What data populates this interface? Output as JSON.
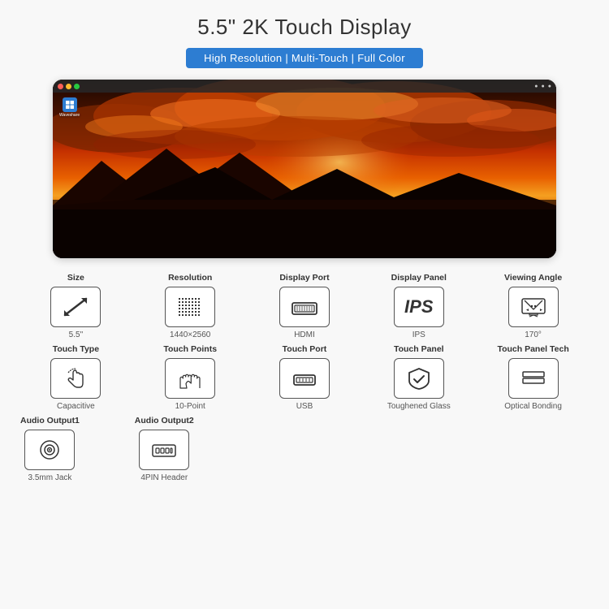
{
  "page": {
    "title": "5.5\" 2K Touch Display",
    "badge": "High Resolution | Multi-Touch | Full Color"
  },
  "specs_row1": [
    {
      "label": "Size",
      "value": "5.5\"",
      "icon": "diagonal-arrow"
    },
    {
      "label": "Resolution",
      "value": "1440×2560",
      "icon": "grid-dots"
    },
    {
      "label": "Display Port",
      "value": "HDMI",
      "icon": "hdmi-port"
    },
    {
      "label": "Display Panel",
      "value": "IPS",
      "icon": "ips-text"
    },
    {
      "label": "Viewing Angle",
      "value": "170°",
      "icon": "viewing-angle"
    }
  ],
  "specs_row2": [
    {
      "label": "Touch Type",
      "value": "Capacitive",
      "icon": "hand-touch"
    },
    {
      "label": "Touch Points",
      "value": "10-Point",
      "icon": "multi-touch"
    },
    {
      "label": "Touch Port",
      "value": "USB",
      "icon": "usb-port"
    },
    {
      "label": "Touch Panel",
      "value": "Toughened Glass",
      "icon": "shield-check"
    },
    {
      "label": "Touch Panel Tech",
      "value": "Optical Bonding",
      "icon": "layers"
    }
  ],
  "specs_row3": [
    {
      "label": "Audio Output1",
      "value": "3.5mm Jack",
      "icon": "audio-jack"
    },
    {
      "label": "Audio Output2",
      "value": "4PIN Header",
      "icon": "pin-header"
    }
  ]
}
